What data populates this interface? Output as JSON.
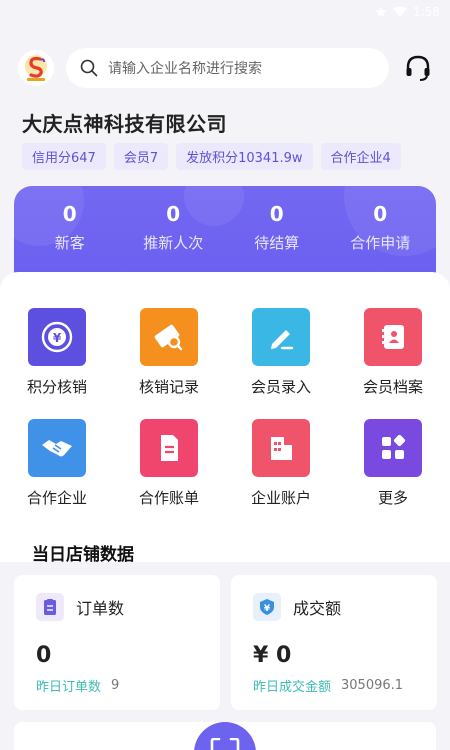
{
  "status": {
    "time": "1:58"
  },
  "header": {
    "logo": "company-logo",
    "search_placeholder": "请输入企业名称进行搜索",
    "support_icon": "headset-icon"
  },
  "company": {
    "name": "大庆点神科技有限公司",
    "badges": [
      "信用分647",
      "会员7",
      "发放积分10341.9w",
      "合作企业4"
    ]
  },
  "stats": [
    {
      "value": "0",
      "label": "新客"
    },
    {
      "value": "0",
      "label": "推新人次"
    },
    {
      "value": "0",
      "label": "待结算"
    },
    {
      "value": "0",
      "label": "合作申请"
    }
  ],
  "grid": [
    {
      "label": "积分核销",
      "icon": "yen-coin-icon",
      "color": "#5d4fe0"
    },
    {
      "label": "核销记录",
      "icon": "ticket-search-icon",
      "color": "#f5901e"
    },
    {
      "label": "会员录入",
      "icon": "pencil-icon",
      "color": "#3bb7e6"
    },
    {
      "label": "会员档案",
      "icon": "contact-book-icon",
      "color": "#f0546b"
    },
    {
      "label": "合作企业",
      "icon": "handshake-icon",
      "color": "#3f92e8"
    },
    {
      "label": "合作账单",
      "icon": "bill-icon",
      "color": "#f0466e"
    },
    {
      "label": "企业账户",
      "icon": "building-icon",
      "color": "#f0546b"
    },
    {
      "label": "更多",
      "icon": "apps-icon",
      "color": "#7a49e0"
    }
  ],
  "section": {
    "title": "当日店铺数据"
  },
  "cards": [
    {
      "title": "订单数",
      "icon": "order-list-icon",
      "value": "0",
      "foot_label": "昨日订单数",
      "foot_value": "9"
    },
    {
      "title": "成交额",
      "icon": "yen-shield-icon",
      "value": "¥ 0",
      "foot_label": "昨日成交金额",
      "foot_value": "305096.1"
    }
  ],
  "bottom": {
    "scan_icon": "scan-icon"
  }
}
